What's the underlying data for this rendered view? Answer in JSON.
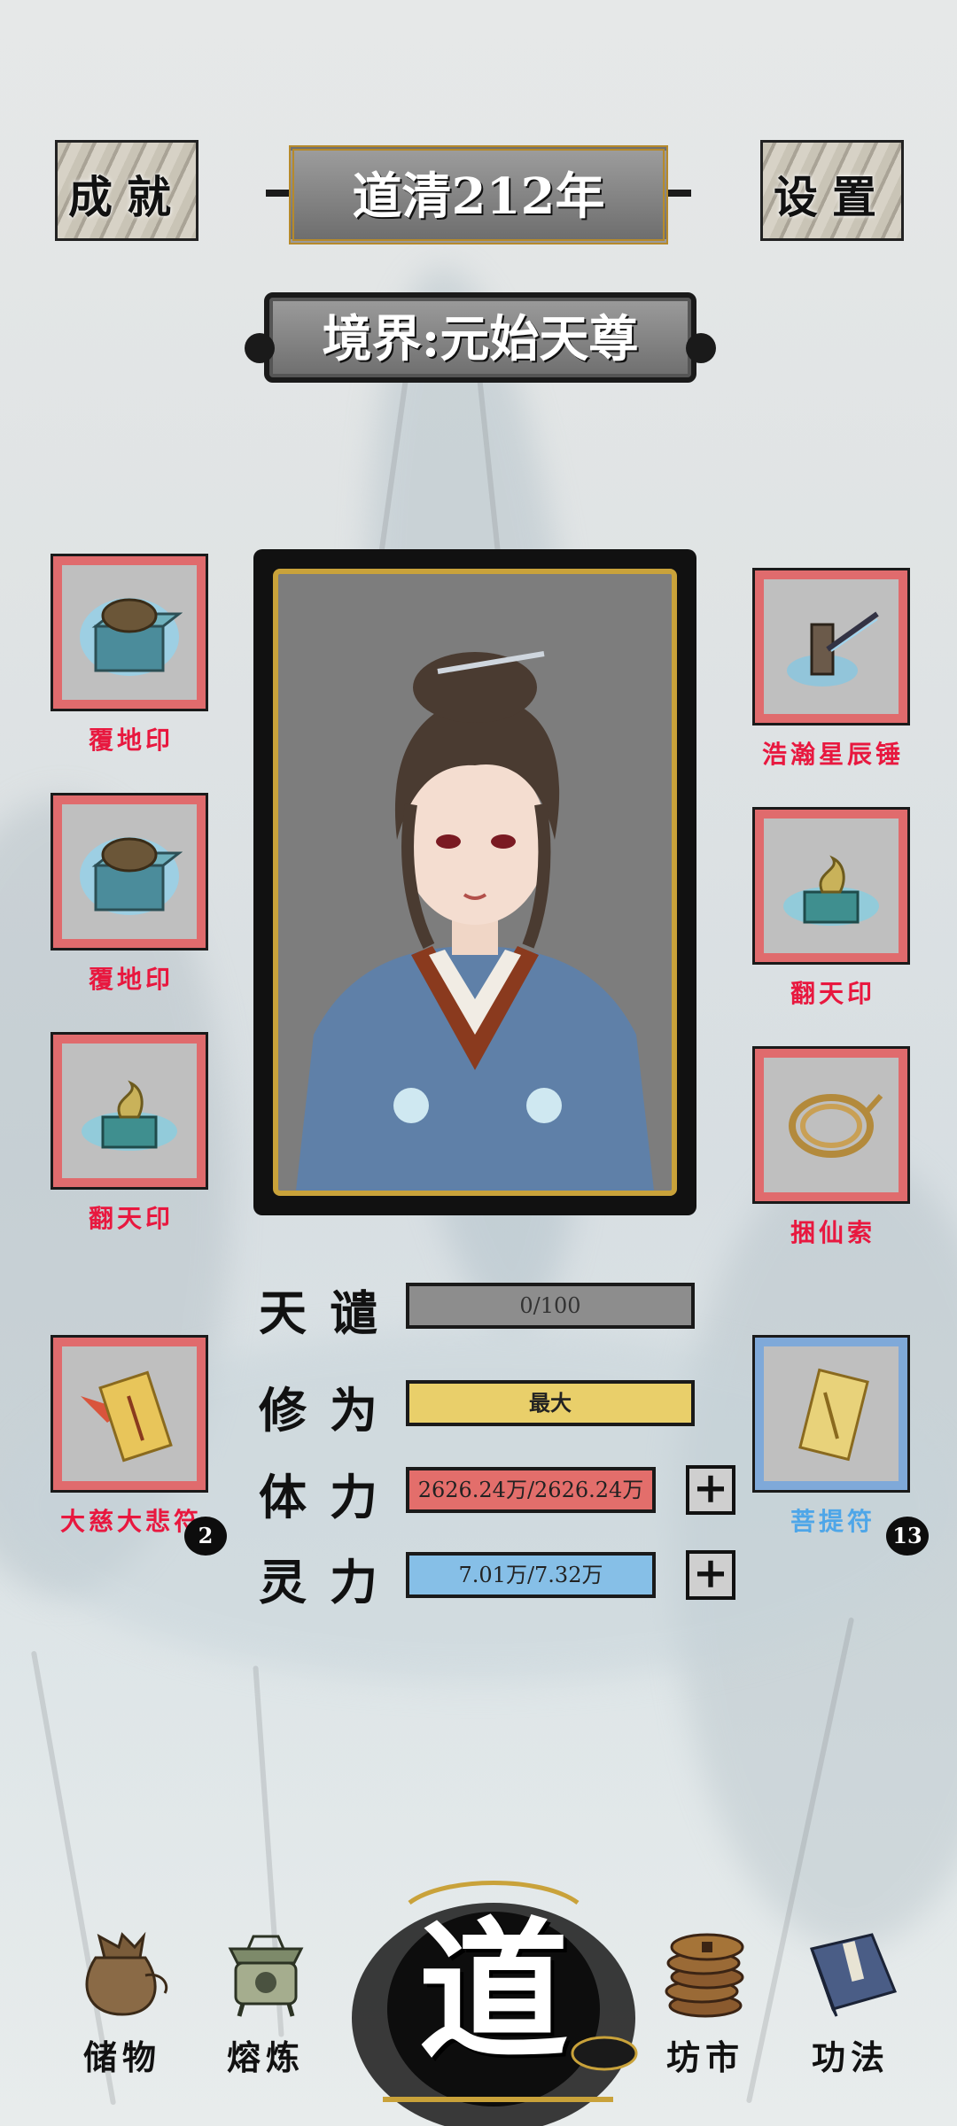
{
  "header": {
    "achievements_label": "成就",
    "settings_label": "设置",
    "year_label": "道清212年",
    "realm_label": "境界:元始天尊"
  },
  "left_slots": [
    {
      "name": "覆地印",
      "icon": "turtle-seal-icon",
      "frame": "#e06b6d"
    },
    {
      "name": "覆地印",
      "icon": "turtle-seal-icon",
      "frame": "#e06b6d"
    },
    {
      "name": "翻天印",
      "icon": "dragon-seal-icon",
      "frame": "#e06b6d"
    },
    {
      "name": "大慈大悲符",
      "icon": "talisman-icon",
      "frame": "#e06b6d",
      "count": "2"
    }
  ],
  "right_slots": [
    {
      "name": "浩瀚星辰锤",
      "icon": "hammer-icon",
      "frame": "#e06b6d"
    },
    {
      "name": "翻天印",
      "icon": "dragon-seal-icon",
      "frame": "#e06b6d"
    },
    {
      "name": "捆仙索",
      "icon": "rope-icon",
      "frame": "#e06b6d"
    },
    {
      "name": "菩提符",
      "icon": "talisman-icon",
      "frame": "#7fa9d9",
      "count": "13"
    }
  ],
  "stats": {
    "tianqian": {
      "label": "天谴",
      "value": "0/100",
      "fill": 0
    },
    "xiuwei": {
      "label": "修为",
      "value": "最大",
      "fill": 1
    },
    "tili": {
      "label": "体力",
      "value": "2626.24万/2626.24万",
      "fill": 1
    },
    "lingli": {
      "label": "灵力",
      "value": "7.01万/7.32万",
      "fill": 0.96
    }
  },
  "nav": {
    "storage": "储物",
    "smelt": "熔炼",
    "dao": "道",
    "market": "坊市",
    "skills": "功法"
  },
  "colors": {
    "red_frame": "#e06b6d",
    "blue_frame": "#7fa9d9",
    "red_name": "#e8183f",
    "blue_name": "#4ea6e8",
    "cultivation_bar": "#e9cf6a",
    "stamina_bar": "#e36e6b",
    "spirit_bar": "#86bfe7"
  }
}
